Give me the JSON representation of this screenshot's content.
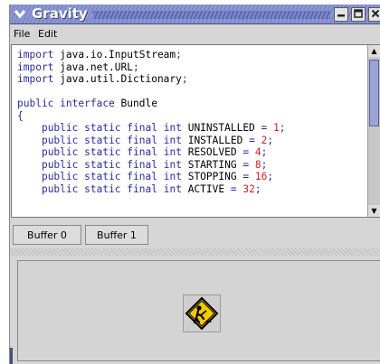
{
  "window": {
    "title": "Gravity",
    "menu_icon": "chevron-down-icon",
    "controls": {
      "minimize_icon": "minimize-icon",
      "maximize_icon": "maximize-icon",
      "close_icon": "close-icon"
    }
  },
  "menubar": {
    "items": [
      {
        "label": "File"
      },
      {
        "label": "Edit"
      }
    ]
  },
  "editor": {
    "lines": [
      "import java.io.InputStream;",
      "import java.net.URL;",
      "import java.util.Dictionary;",
      "",
      "public interface Bundle",
      "{",
      "    public static final int UNINSTALLED = 1;",
      "    public static final int INSTALLED = 2;",
      "    public static final int RESOLVED = 4;",
      "    public static final int STARTING = 8;",
      "    public static final int STOPPING = 16;",
      "    public static final int ACTIVE = 32;"
    ]
  },
  "tabs": [
    {
      "label": "Buffer 0"
    },
    {
      "label": "Buffer 1"
    }
  ],
  "bottom_panel": {
    "icon": "construction-worker-icon"
  },
  "colors": {
    "titlebar": "#7c88c8",
    "keyword": "#2b2b9e",
    "number": "#d02020",
    "background": "#d6d6d6",
    "sign_yellow": "#f2cc00"
  }
}
